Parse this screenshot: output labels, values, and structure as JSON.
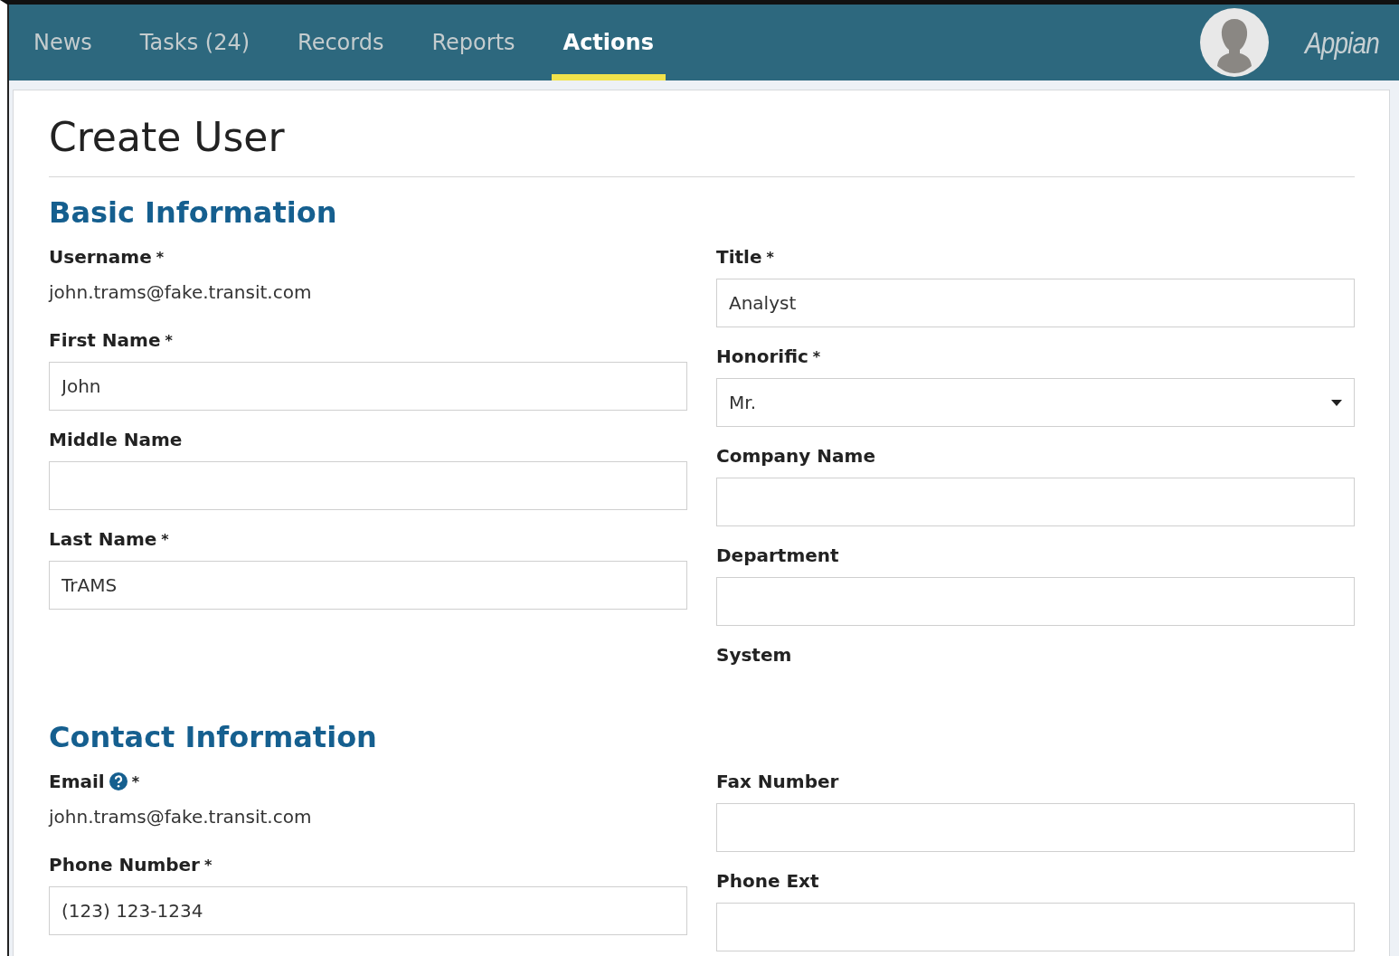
{
  "nav": {
    "tabs": [
      {
        "label": "News",
        "selected": false
      },
      {
        "label": "Tasks (24)",
        "selected": false
      },
      {
        "label": "Records",
        "selected": false
      },
      {
        "label": "Reports",
        "selected": false
      },
      {
        "label": "Actions",
        "selected": true
      }
    ],
    "brand": "Appian"
  },
  "page": {
    "title": "Create User",
    "sections": [
      {
        "heading": "Basic Information",
        "columns": [
          [
            {
              "kind": "static",
              "label": "Username",
              "marker": "*",
              "value": "john.trams@fake.transit.com"
            },
            {
              "kind": "input",
              "label": "First Name",
              "marker": "*",
              "value": "John"
            },
            {
              "kind": "input",
              "label": "Middle Name"
            },
            {
              "kind": "input",
              "label": "Last Name",
              "marker": "*",
              "value": "TrAMS"
            }
          ],
          [
            {
              "kind": "input",
              "label": "Title",
              "marker": "*",
              "value": "Analyst"
            },
            {
              "kind": "select",
              "label": "Honorific",
              "marker": "*",
              "value": "Mr."
            },
            {
              "kind": "input",
              "label": "Company Name"
            },
            {
              "kind": "input",
              "label": "Department"
            },
            {
              "kind": "label",
              "label": "System"
            }
          ]
        ]
      },
      {
        "heading": "Contact Information",
        "columns": [
          [
            {
              "kind": "static",
              "label": "Email",
              "help": true,
              "marker": "*",
              "value": "john.trams@fake.transit.com"
            },
            {
              "kind": "input",
              "label": "Phone Number",
              "marker": "*",
              "value": "(123) 123-1234"
            }
          ],
          [
            {
              "kind": "input",
              "label": "Fax Number"
            },
            {
              "kind": "input",
              "label": "Phone Ext"
            }
          ]
        ]
      }
    ]
  }
}
